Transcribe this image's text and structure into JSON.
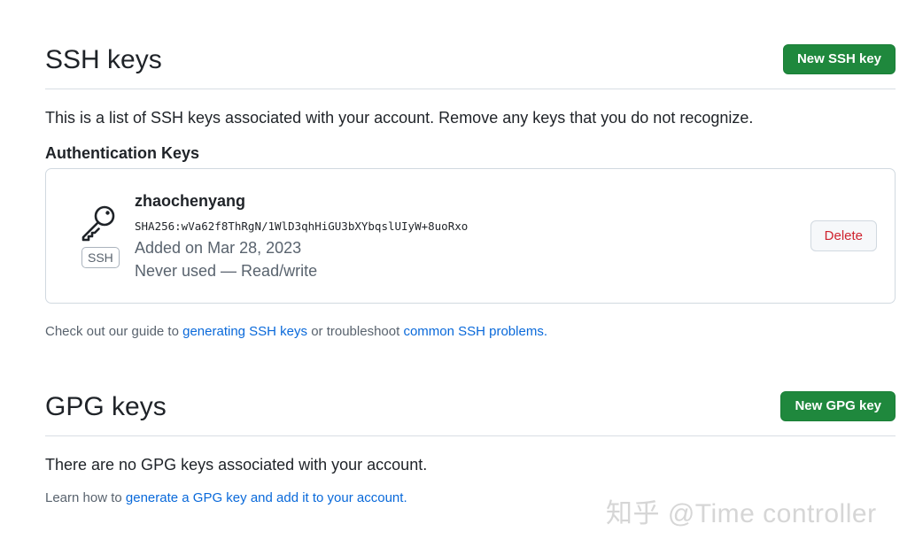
{
  "ssh": {
    "title": "SSH keys",
    "new_button": "New SSH key",
    "description": "This is a list of SSH keys associated with your account. Remove any keys that you do not recognize.",
    "auth_heading": "Authentication Keys",
    "key": {
      "icon": "key-icon",
      "badge": "SSH",
      "name": "zhaochenyang",
      "fingerprint": "SHA256:wVa62f8ThRgN/1WlD3qhHiGU3bXYbqslUIyW+8uoRxo",
      "added": "Added on Mar 28, 2023",
      "usage": "Never used — Read/write",
      "delete_button": "Delete"
    },
    "guide": {
      "prefix": "Check out our guide to ",
      "link1": "generating SSH keys",
      "middle": " or troubleshoot ",
      "link2": "common SSH problems",
      "suffix": "."
    }
  },
  "gpg": {
    "title": "GPG keys",
    "new_button": "New GPG key",
    "empty_text": "There are no GPG keys associated with your account.",
    "learn": {
      "prefix": "Learn how to ",
      "link": "generate a GPG key and add it to your account",
      "suffix": "."
    }
  },
  "watermark": "知乎 @Time controller",
  "colors": {
    "green_button": "#1f883d",
    "link": "#0969da",
    "danger": "#cf222e",
    "muted": "#59636e"
  }
}
